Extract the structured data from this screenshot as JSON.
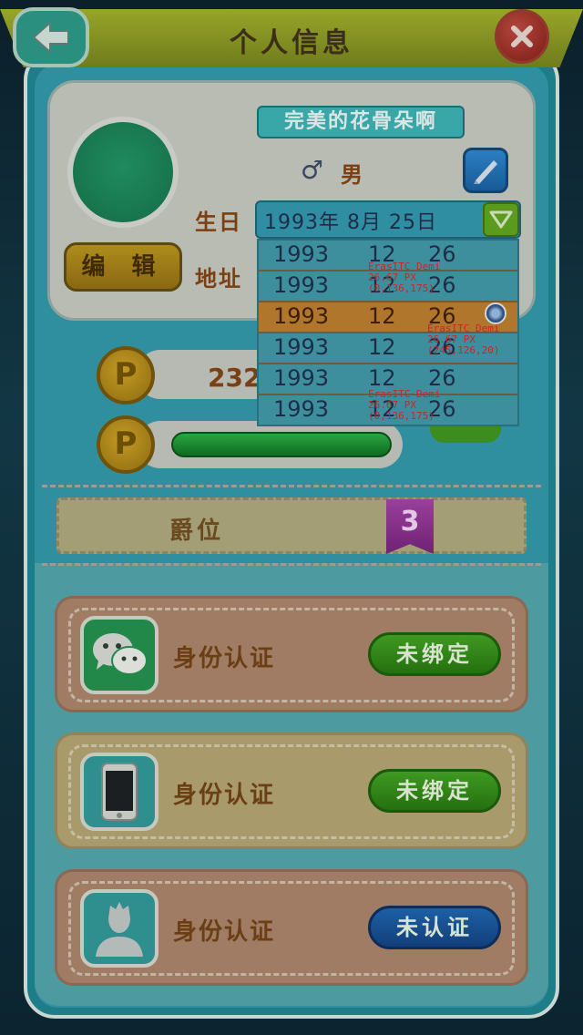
{
  "colors": {
    "title_bar": "#6f7c1b",
    "panel": "#1d7e8a",
    "label_brown": "#7a3f13",
    "button_green": "#25700f",
    "button_blue": "#123f7a",
    "annotation_red": "#c62828"
  },
  "header": {
    "title": "个人信息",
    "back_icon": "arrow-left-icon",
    "close_icon": "close-x-icon"
  },
  "profile": {
    "nickname": "完美的花骨朵啊",
    "gender_symbol": "♂",
    "gender": "男",
    "edit_label": "编 辑",
    "edit_icon": "pen-icon",
    "birthday_label": "生日",
    "address_label": "地址",
    "birthday": {
      "selected_display": "1993年 8月 25日",
      "options": [
        {
          "year": "1993",
          "month": "12",
          "day": "26"
        },
        {
          "year": "1993",
          "month": "12",
          "day": "26"
        },
        {
          "year": "1993",
          "month": "12",
          "day": "26"
        },
        {
          "year": "1993",
          "month": "12",
          "day": "26"
        },
        {
          "year": "1993",
          "month": "12",
          "day": "26"
        },
        {
          "year": "1993",
          "month": "12",
          "day": "26"
        }
      ]
    }
  },
  "annotations": [
    "ErasITC Demi\n26.67 PX\n(0,136,175)",
    "ErasITC Demi\n26.67 PX\n(245,126,20)",
    "ErasITC Demi\n26.67 PX\n(0,136,175)"
  ],
  "points": {
    "coin_letter": "P",
    "value": "232"
  },
  "rank": {
    "label": "爵位",
    "level": "3"
  },
  "auth": [
    {
      "icon": "wechat-icon",
      "label": "身份认证",
      "button": "未绑定",
      "style": "green"
    },
    {
      "icon": "phone-icon",
      "label": "身份认证",
      "button": "未绑定",
      "style": "green"
    },
    {
      "icon": "person-icon",
      "label": "身份认证",
      "button": "未认证",
      "style": "blue"
    }
  ]
}
